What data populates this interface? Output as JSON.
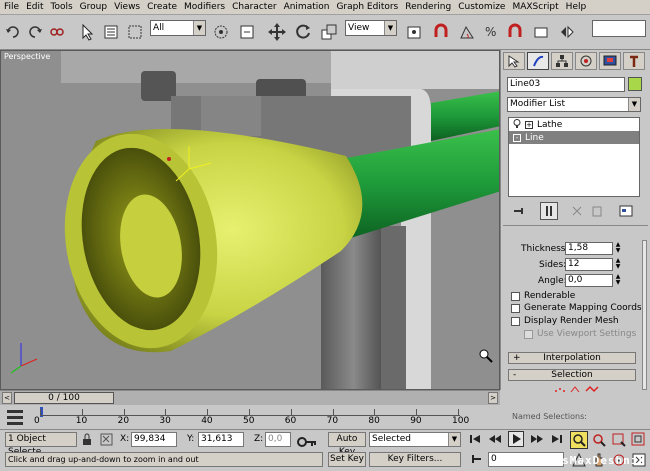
{
  "menu": [
    "File",
    "Edit",
    "Tools",
    "Group",
    "Views",
    "Create",
    "Modifiers",
    "Character",
    "Animation",
    "Graph Editors",
    "Rendering",
    "Customize",
    "MAXScript",
    "Help"
  ],
  "toolbar": {
    "filter_value": "All",
    "coord_value": "View"
  },
  "viewport": {
    "label": "Perspective"
  },
  "cmd": {
    "object_name": "Line03",
    "modifier_list": "Modifier List",
    "stack": [
      {
        "label": "Lathe",
        "sign": "+"
      },
      {
        "label": "Line",
        "sign": "-"
      }
    ],
    "params": {
      "thickness_label": "Thickness:",
      "thickness_value": "1,58",
      "sides_label": "Sides:",
      "sides_value": "12",
      "angle_label": "Angle:",
      "angle_value": "0,0",
      "renderable": "Renderable",
      "gen_mapping": "Generate Mapping Coords.",
      "display_render": "Display Render Mesh",
      "use_viewport": "Use Viewport Settings"
    },
    "rollouts": {
      "interp_sign": "+",
      "interpolation": "Interpolation",
      "sel_sign": "-",
      "selection": "Selection",
      "named": "Named Selections:"
    }
  },
  "time": {
    "slider": "0 / 100",
    "ticks": [
      "0",
      "10",
      "20",
      "30",
      "40",
      "50",
      "60",
      "70",
      "80",
      "90",
      "100"
    ]
  },
  "status": {
    "selected": "1 Object Selecte",
    "x_label": "X:",
    "x_value": "99,834",
    "y_label": "Y:",
    "y_value": "31,613",
    "z_label": "Z:",
    "z_value": "0,0",
    "autokey": "Auto Key",
    "key_dropdown": "Selected",
    "setkey": "Set Key",
    "keyfilters": "Key Filters...",
    "prompt": "Click and drag up-and-down to zoom in and out",
    "frame": "0"
  },
  "watermark": "3dsMaxDeshnik",
  "colors": {
    "cone": "#c8d444",
    "bar": "#1e9a3a",
    "viewport": "#8f8f8f"
  }
}
